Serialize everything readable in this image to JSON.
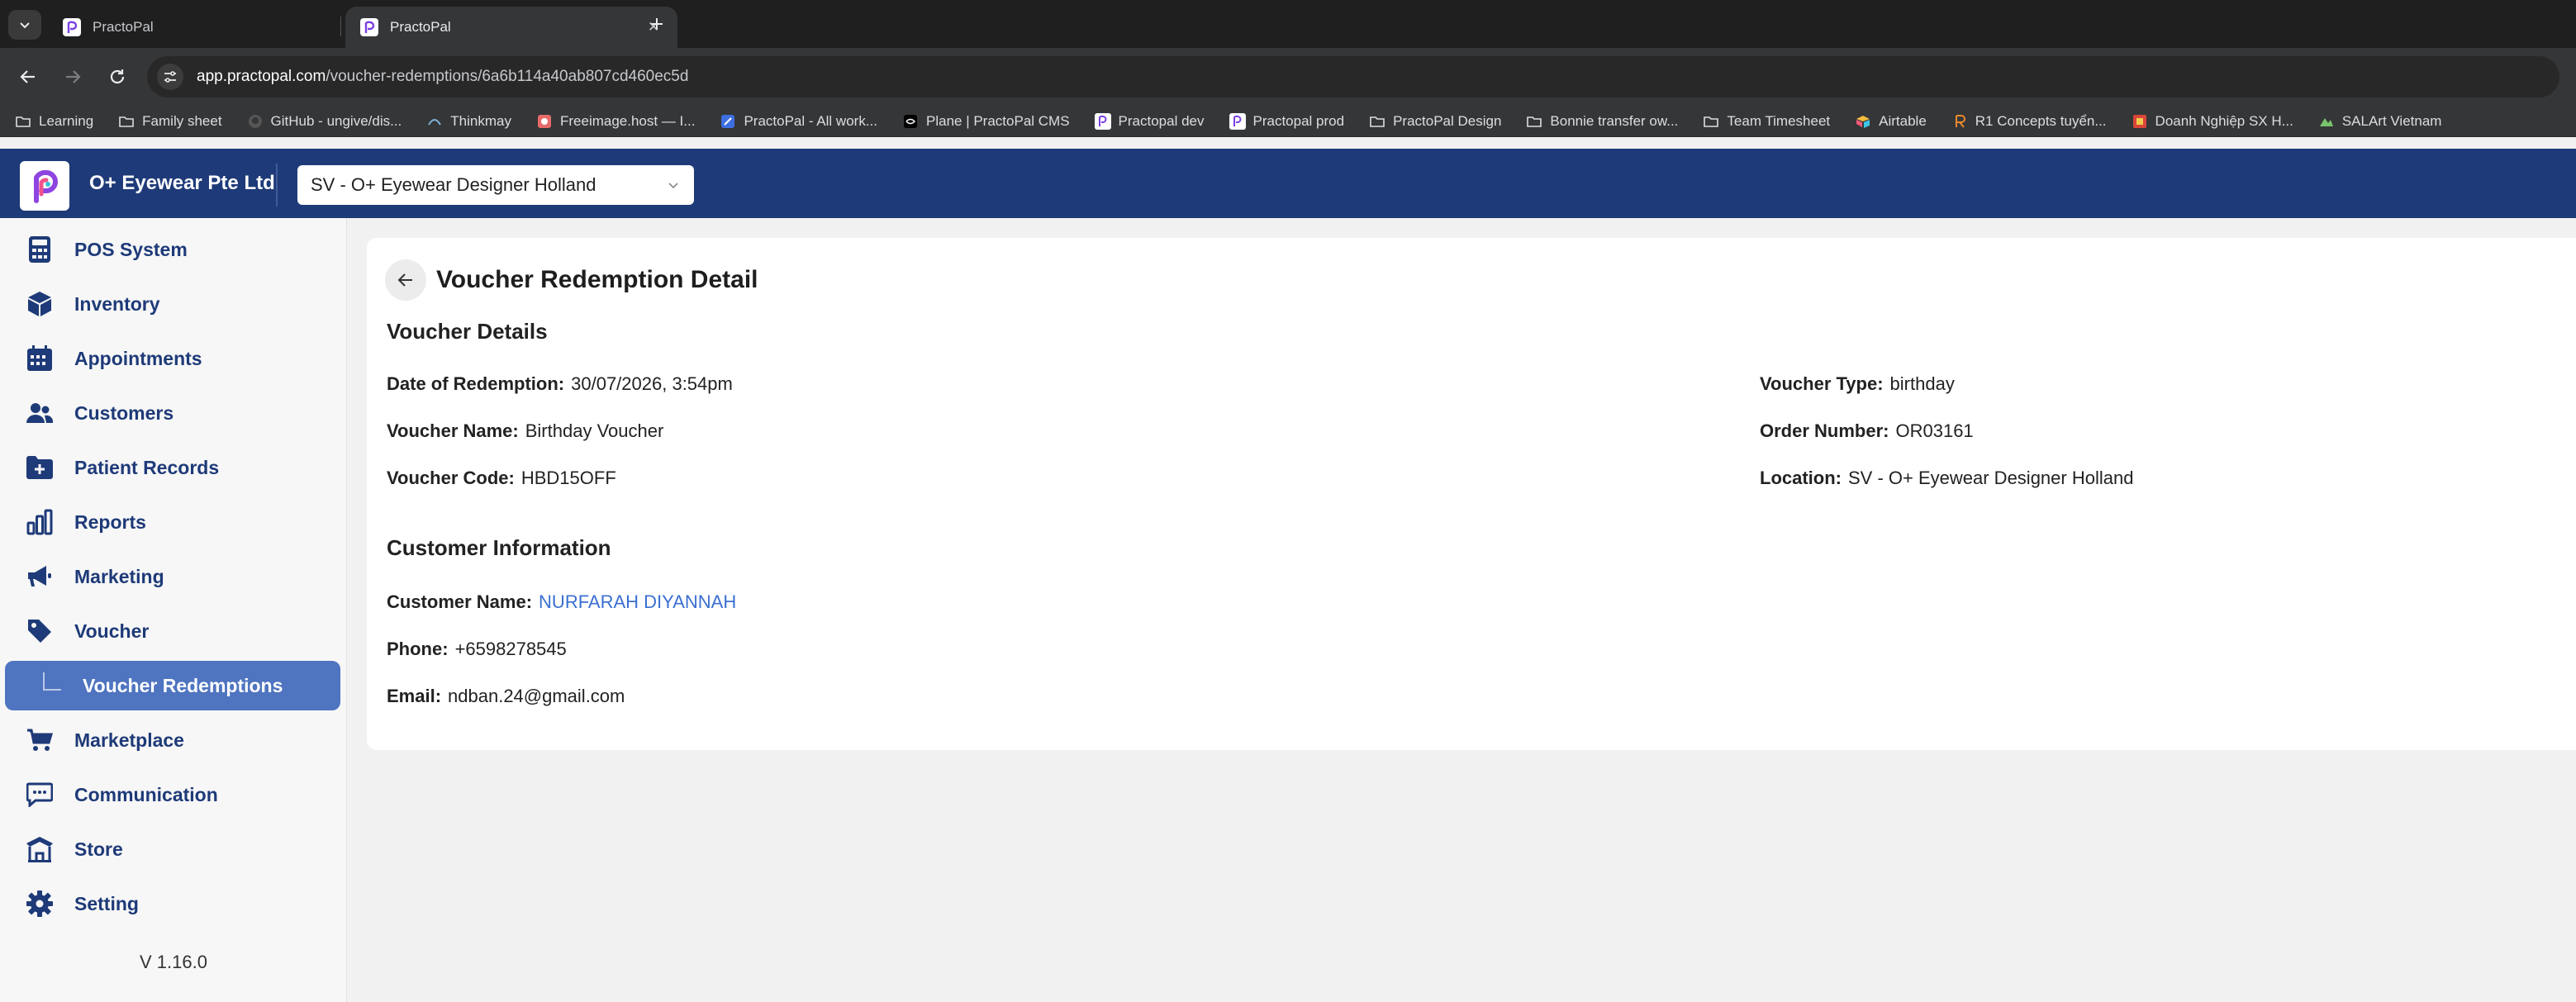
{
  "browser": {
    "tabs": [
      {
        "title": "PractoPal",
        "active": false
      },
      {
        "title": "PractoPal",
        "active": true
      }
    ],
    "url_host": "app.practopal.com",
    "url_path": "/voucher-redemptions/6a6b114a40ab807cd460ec5d",
    "bookmarks": [
      {
        "label": "Learning",
        "icon": "folder-icon"
      },
      {
        "label": "Family sheet",
        "icon": "folder-icon"
      },
      {
        "label": "GitHub - ungive/dis...",
        "icon": "github-icon"
      },
      {
        "label": "Thinkmay",
        "icon": "thinkmay-icon"
      },
      {
        "label": "Freeimage.host — I...",
        "icon": "freeimage-icon"
      },
      {
        "label": "PractoPal - All work...",
        "icon": "practopal-work-icon"
      },
      {
        "label": "Plane | PractoPal CMS",
        "icon": "plane-icon"
      },
      {
        "label": "Practopal dev",
        "icon": "practopal-icon"
      },
      {
        "label": "Practopal prod",
        "icon": "practopal-icon"
      },
      {
        "label": "PractoPal Design",
        "icon": "folder-icon"
      },
      {
        "label": "Bonnie transfer ow...",
        "icon": "folder-icon"
      },
      {
        "label": "Team Timesheet",
        "icon": "folder-icon"
      },
      {
        "label": "Airtable",
        "icon": "airtable-icon"
      },
      {
        "label": "R1 Concepts tuyển...",
        "icon": "r1-icon"
      },
      {
        "label": "Doanh Nghiệp SX H...",
        "icon": "doanh-nghiep-icon"
      },
      {
        "label": "SALArt Vietnam",
        "icon": "salart-icon"
      }
    ]
  },
  "header": {
    "company": "O+ Eyewear Pte Ltd",
    "location": "SV - O+ Eyewear Designer Holland"
  },
  "sidebar": {
    "items": [
      {
        "label": "POS System",
        "icon": "calculator-icon"
      },
      {
        "label": "Inventory",
        "icon": "cube-icon"
      },
      {
        "label": "Appointments",
        "icon": "calendar-icon"
      },
      {
        "label": "Customers",
        "icon": "users-icon"
      },
      {
        "label": "Patient Records",
        "icon": "folder-plus-icon"
      },
      {
        "label": "Reports",
        "icon": "bar-chart-icon"
      },
      {
        "label": "Marketing",
        "icon": "megaphone-icon"
      },
      {
        "label": "Voucher",
        "icon": "tag-icon"
      },
      {
        "label": "Voucher Redemptions",
        "icon": "sub-item-corner",
        "active": true
      },
      {
        "label": "Marketplace",
        "icon": "cart-icon"
      },
      {
        "label": "Communication",
        "icon": "chat-icon"
      },
      {
        "label": "Store",
        "icon": "store-icon"
      },
      {
        "label": "Setting",
        "icon": "gear-icon"
      }
    ],
    "version": "V 1.16.0"
  },
  "main": {
    "title": "Voucher Redemption Detail",
    "voucher_section": "Voucher Details",
    "voucher_fields": {
      "date_label": "Date of Redemption",
      "date_value": "30/07/2026, 3:54pm",
      "name_label": "Voucher Name",
      "name_value": "Birthday Voucher",
      "code_label": "Voucher Code",
      "code_value": "HBD15OFF",
      "type_label": "Voucher Type",
      "type_value": "birthday",
      "order_label": "Order Number",
      "order_value": "OR03161",
      "location_label": "Location",
      "location_value": "SV - O+ Eyewear Designer Holland"
    },
    "customer_section": "Customer Information",
    "customer_fields": {
      "name_label": "Customer Name",
      "name_value": "NURFARAH DIYANNAH",
      "phone_label": "Phone",
      "phone_value": "+6598278545",
      "email_label": "Email",
      "email_value": "ndban.24@gmail.com"
    },
    "separator": ":"
  },
  "colors": {
    "brand_navy": "#1e3a78",
    "active_nav": "#4f74c0",
    "link": "#3b6fd1"
  }
}
